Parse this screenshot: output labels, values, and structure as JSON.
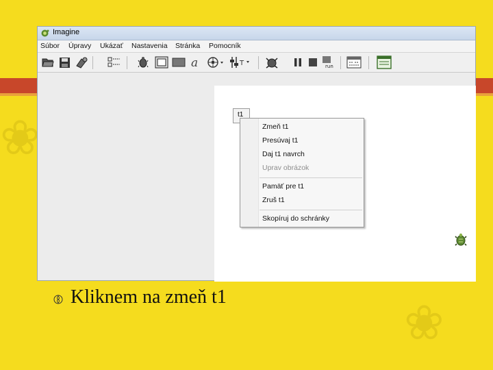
{
  "window": {
    "title": "Imagine",
    "menu": [
      "Súbor",
      "Úpravy",
      "Ukázať",
      "Nastavenia",
      "Stránka",
      "Pomocník"
    ]
  },
  "toolbar": {
    "icons": [
      "open-folder-icon",
      "save-icon",
      "tools-icon",
      "grid-layout-icon",
      "turtle-icon",
      "frame-icon",
      "rectangle-icon",
      "text-a-icon",
      "navigation-icon",
      "slider-icon",
      "turtle-run-icon",
      "pause-icon",
      "stop-icon",
      "run-icon",
      "window-icon",
      "page-icon"
    ],
    "run_label": "run"
  },
  "canvas": {
    "object_button_label": "t1"
  },
  "context_menu": {
    "items": [
      {
        "label": "Zmeň t1",
        "enabled": true
      },
      {
        "label": "Presúvaj t1",
        "enabled": true
      },
      {
        "label": "Daj t1 navrch",
        "enabled": true
      },
      {
        "label": "Uprav obrázok",
        "enabled": false
      },
      {
        "label": "Pamäť pre t1",
        "enabled": true
      },
      {
        "label": "Zruš t1",
        "enabled": true
      },
      {
        "label": "Skopíruj do schránky",
        "enabled": true
      }
    ]
  },
  "slide": {
    "caption": "Kliknem na zmeň t1",
    "bullet_icon": "flower-bullet-icon",
    "colors": {
      "background": "#f5dc1e",
      "accent_band": "#c8472a"
    }
  }
}
